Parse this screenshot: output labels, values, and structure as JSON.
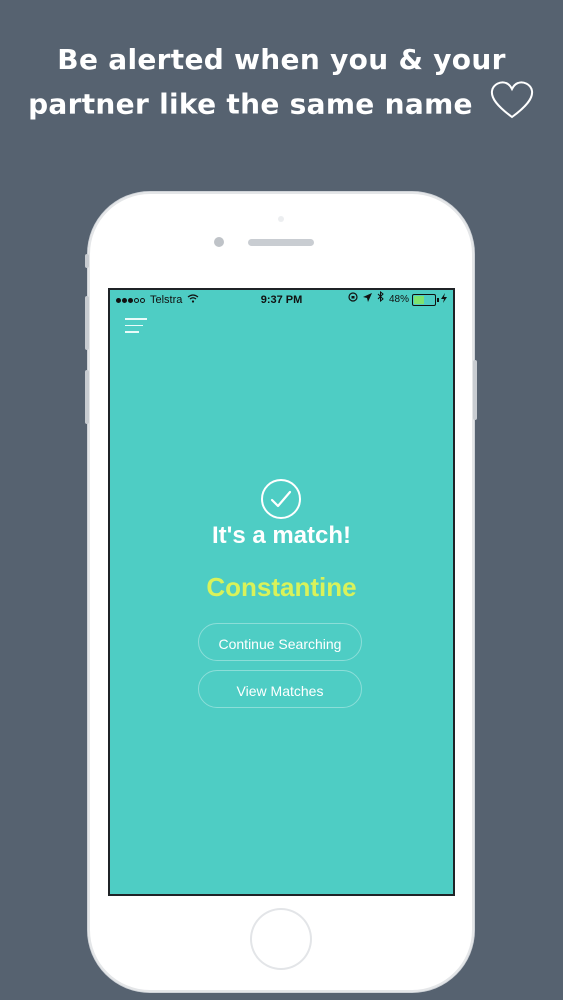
{
  "promo": {
    "headline_line1": "Be alerted when you & your",
    "headline_line2": "partner like the same name"
  },
  "status_bar": {
    "carrier": "Telstra",
    "time": "9:37 PM",
    "battery": "48%",
    "battery_level": 0.48
  },
  "match": {
    "title": "It's a match!",
    "name": "Constantine"
  },
  "buttons": {
    "continue_label": "Continue Searching",
    "view_label": "View Matches"
  },
  "colors": {
    "background": "#566270",
    "screen": "#4ecdc4",
    "name_accent": "#d9f25a",
    "battery": "#7ee36f"
  },
  "icons": [
    "heart-icon",
    "wifi-icon",
    "lock-rotation-icon",
    "location-arrow-icon",
    "bluetooth-icon",
    "battery-icon",
    "charging-icon",
    "menu-icon",
    "check-circle-icon"
  ]
}
